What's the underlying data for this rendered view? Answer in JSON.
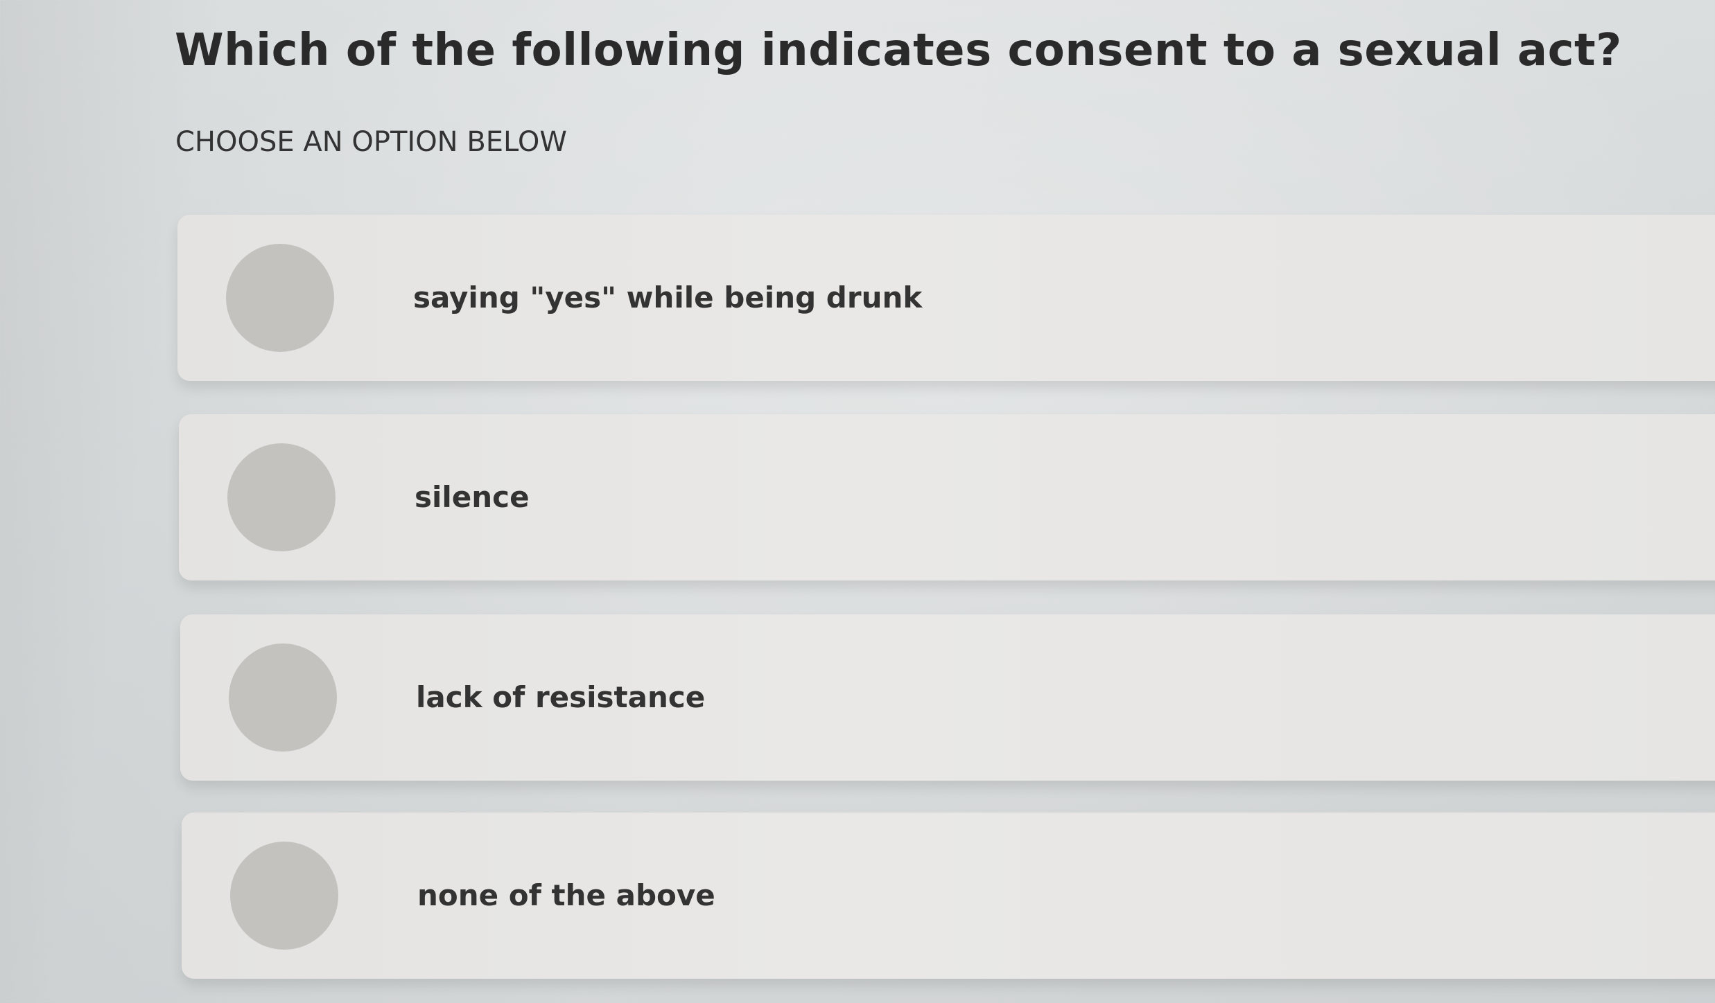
{
  "question": {
    "title": "Which of the following indicates consent to a sexual act?",
    "subtitle": "CHOOSE AN OPTION BELOW"
  },
  "options": [
    {
      "label": "saying \"yes\" while being drunk",
      "selected": false
    },
    {
      "label": "silence",
      "selected": false
    },
    {
      "label": "lack of resistance",
      "selected": false
    },
    {
      "label": "none of the above",
      "selected": false
    }
  ],
  "colors": {
    "background": "#d9dcdd",
    "option_card": "#e7e6e4",
    "radio": "#c3c2bf",
    "text": "#2a2a2a"
  }
}
